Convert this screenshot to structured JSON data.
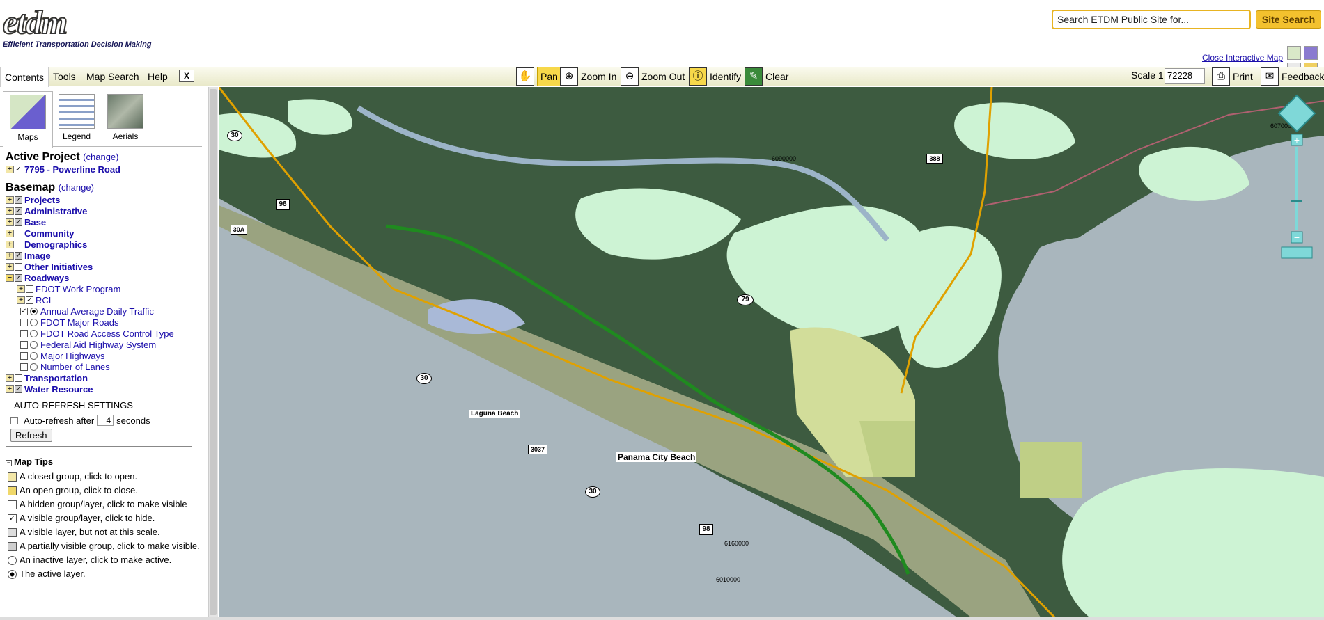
{
  "header": {
    "logo_text": "etdm",
    "logo_subtitle": "Efficient Transportation Decision Making",
    "search_placeholder": "Search ETDM Public Site for...",
    "search_button": "Site Search",
    "close_map_link": "Close Interactive Map",
    "feedback_label": "Feedback"
  },
  "tabs": [
    {
      "label": "Contents"
    },
    {
      "label": "Tools"
    },
    {
      "label": "Map Search"
    },
    {
      "label": "Help"
    },
    {
      "label": "X"
    }
  ],
  "tools": {
    "pan": "Pan",
    "zoom_in": "Zoom In",
    "zoom_out": "Zoom Out",
    "identify": "Identify",
    "clear": "Clear",
    "print": "Print"
  },
  "scale": {
    "label": "Scale 1:",
    "value": "72228"
  },
  "subtabs": [
    {
      "label": "Maps"
    },
    {
      "label": "Legend"
    },
    {
      "label": "Aerials"
    }
  ],
  "active_project": {
    "heading": "Active Project",
    "change": "(change)",
    "name": "7795 - Powerline Road"
  },
  "basemap": {
    "heading": "Basemap",
    "change": "(change)",
    "groups": [
      "Projects",
      "Administrative",
      "Base",
      "Community",
      "Demographics",
      "Image",
      "Other Initiatives",
      "Roadways"
    ],
    "roadway_subgroups": [
      "FDOT Work Program",
      "RCI"
    ],
    "roadway_layers": [
      "Annual Average Daily Traffic",
      "FDOT Major Roads",
      "FDOT Road Access Control Type",
      "Federal Aid Highway System",
      "Major Highways",
      "Number of Lanes"
    ],
    "after_groups": [
      "Transportation",
      "Water Resource"
    ]
  },
  "auto_refresh": {
    "legend": "AUTO-REFRESH SETTINGS",
    "label": "Auto-refresh after",
    "value": "4",
    "unit": "seconds",
    "button": "Refresh"
  },
  "map_tips": {
    "heading": "Map Tips",
    "items": [
      "A closed group, click to open.",
      "An open group, click to close.",
      "A hidden group/layer, click to make visible",
      "A visible group/layer, click to hide.",
      "A visible layer, but not at this scale.",
      "A partially visible group, click to make visible.",
      "An inactive layer, click to make active.",
      "The active layer."
    ]
  },
  "map_labels": {
    "place1": "Panama City Beach",
    "place2": "Laguna Beach",
    "shields": [
      "30",
      "98",
      "30A",
      "30",
      "3037",
      "30",
      "98",
      "79",
      "388"
    ],
    "stations": [
      "6090000",
      "6070000",
      "6160000",
      "6010000"
    ]
  }
}
